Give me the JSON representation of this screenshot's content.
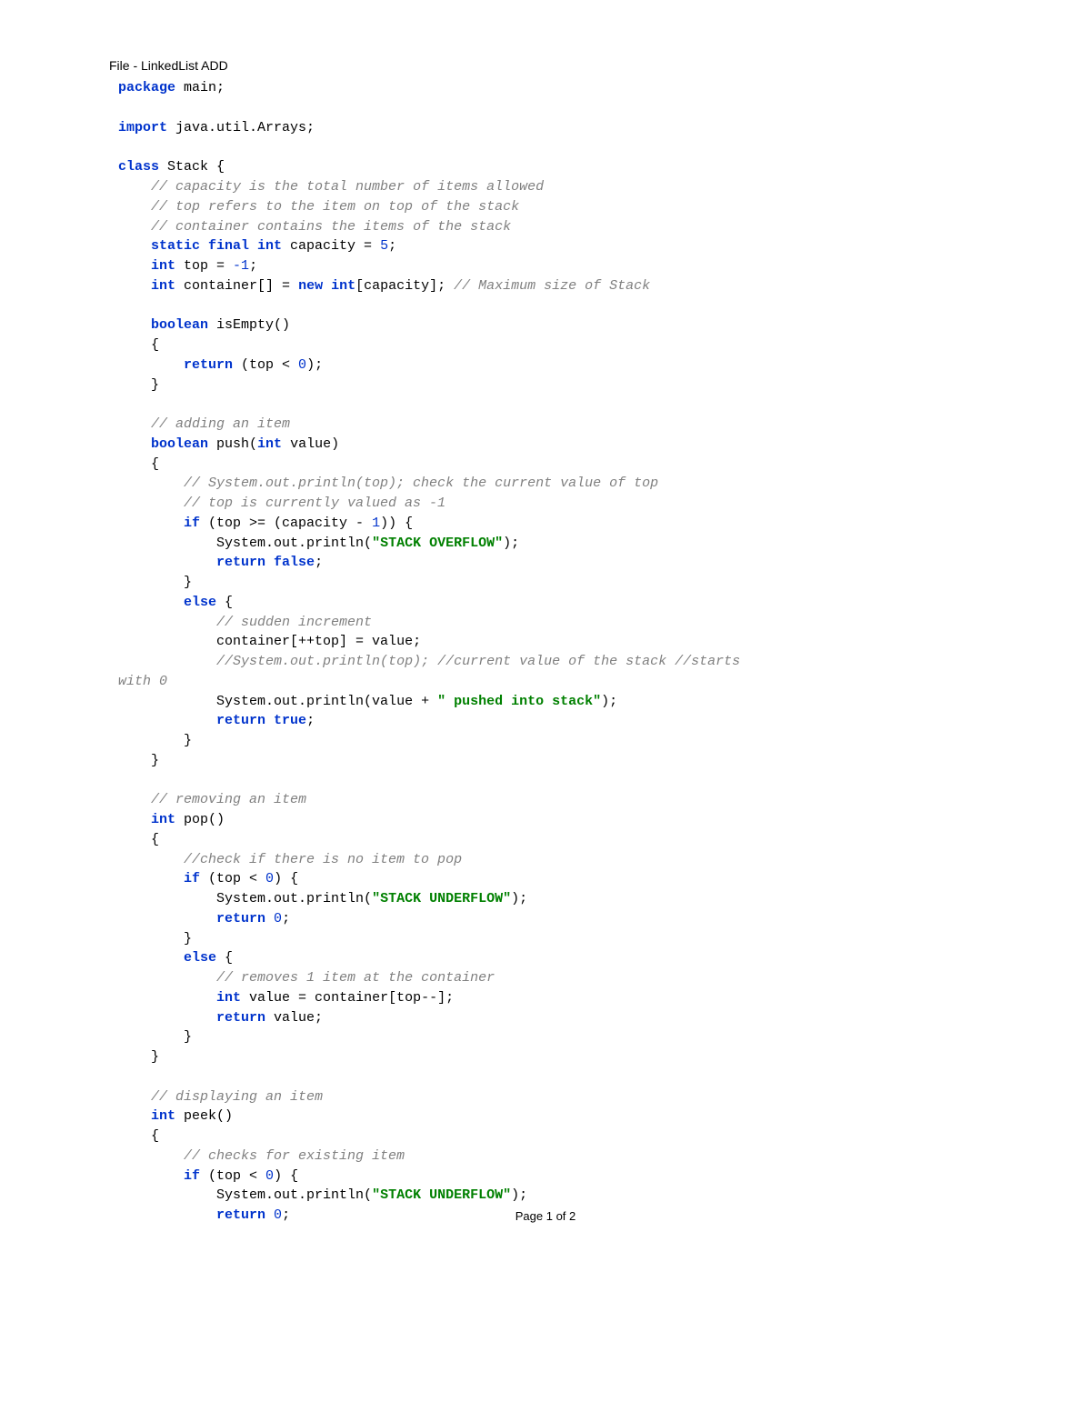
{
  "header": "File - LinkedList ADD",
  "footer": "Page 1 of 2",
  "code": {
    "l1a": "package",
    "l1b": " main;",
    "l2a": "import",
    "l2b": " java.util.Arrays;",
    "l3a": "class",
    "l3b": " Stack {",
    "l4": "// capacity is the total number of items allowed",
    "l5": "// top refers to the item on top of the stack",
    "l6": "// container contains the items of the stack",
    "l7a": "static final int",
    "l7b": " capacity = ",
    "l7c": "5",
    "l7d": ";",
    "l8a": "int",
    "l8b": " top = ",
    "l8c": "-1",
    "l8d": ";",
    "l9a": "int",
    "l9b": " container[] = ",
    "l9c": "new int",
    "l9d": "[capacity]; ",
    "l9e": "// Maximum size of Stack",
    "l10a": "boolean",
    "l10b": " isEmpty()",
    "l11": "{",
    "l12a": "return",
    "l12b": " (top < ",
    "l12c": "0",
    "l12d": ");",
    "l13": "}",
    "l14": "// adding an item",
    "l15a": "boolean",
    "l15b": " push(",
    "l15c": "int",
    "l15d": " value)",
    "l16": "{",
    "l17": "// System.out.println(top); check the current value of top",
    "l18": "// top is currently valued as -1",
    "l19a": "if",
    "l19b": " (top >= (capacity - ",
    "l19c": "1",
    "l19d": ")) {",
    "l20a": "System.out.println(",
    "l20b": "\"STACK OVERFLOW\"",
    "l20c": ");",
    "l21a": "return false",
    "l21b": ";",
    "l22": "}",
    "l23a": "else",
    "l23b": " {",
    "l24": "// sudden increment",
    "l25": "container[++top] = value;",
    "l26": "//System.out.println(top); //current value of the stack //starts",
    "l26b": "with 0",
    "l27a": "System.out.println(value + ",
    "l27b": "\" pushed into stack\"",
    "l27c": ");",
    "l28a": "return true",
    "l28b": ";",
    "l29": "}",
    "l30": "}",
    "l31": "// removing an item",
    "l32a": "int",
    "l32b": " pop()",
    "l33": "{",
    "l34": "//check if there is no item to pop",
    "l35a": "if",
    "l35b": " (top < ",
    "l35c": "0",
    "l35d": ") {",
    "l36a": "System.out.println(",
    "l36b": "\"STACK UNDERFLOW\"",
    "l36c": ");",
    "l37a": "return ",
    "l37b": "0",
    "l37c": ";",
    "l38": "}",
    "l39a": "else",
    "l39b": " {",
    "l40": "// removes 1 item at the container",
    "l41a": "int",
    "l41b": " value = container[top--];",
    "l42a": "return",
    "l42b": " value;",
    "l43": "}",
    "l44": "}",
    "l45": "// displaying an item",
    "l46a": "int",
    "l46b": " peek()",
    "l47": "{",
    "l48": "// checks for existing item",
    "l49a": "if",
    "l49b": " (top < ",
    "l49c": "0",
    "l49d": ") {",
    "l50a": "System.out.println(",
    "l50b": "\"STACK UNDERFLOW\"",
    "l50c": ");",
    "l51a": "return ",
    "l51b": "0",
    "l51c": ";"
  }
}
